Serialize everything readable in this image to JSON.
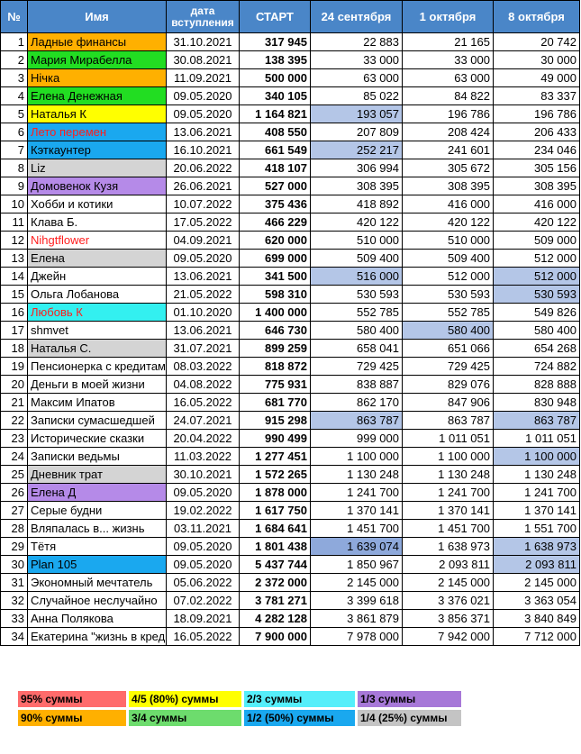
{
  "header": {
    "no": "№",
    "name": "Имя",
    "date": "дата вступления",
    "start": "СТАРТ",
    "c1": "24 сентября",
    "c2": "1 октября",
    "c3": "8 октября"
  },
  "colors": {
    "header": "#4a86c8",
    "orange": "#ffb000",
    "green": "#22dd22",
    "yellow": "#ffff00",
    "blue": "#1aa8ef",
    "gray": "#d4d4d4",
    "purple": "#b58ae8",
    "cyan": "#33f0f0",
    "highlight": "#b4c6e7",
    "highlight_strong": "#8ea9db"
  },
  "rows": [
    {
      "n": "1",
      "name": "Ладные финансы",
      "date": "31.10.2021",
      "start": "317 945",
      "c1": "22 883",
      "c2": "21 165",
      "c3": "20 742",
      "bg": "orange"
    },
    {
      "n": "2",
      "name": "Мария Мирабелла",
      "date": "30.08.2021",
      "start": "138 395",
      "c1": "33 000",
      "c2": "33 000",
      "c3": "30 000",
      "bg": "green"
    },
    {
      "n": "3",
      "name": "Нічка",
      "date": "11.09.2021",
      "start": "500 000",
      "c1": "63 000",
      "c2": "63 000",
      "c3": "49 000",
      "bg": "orange"
    },
    {
      "n": "4",
      "name": "Елена Денежная",
      "date": "09.05.2020",
      "start": "340 105",
      "c1": "85 022",
      "c2": "84 822",
      "c3": "83 337",
      "bg": "green"
    },
    {
      "n": "5",
      "name": "Наталья К",
      "date": "09.05.2020",
      "start": "1 164 821",
      "c1": "193 057",
      "c2": "196 786",
      "c3": "196 786",
      "bg": "yellow",
      "h1": true
    },
    {
      "n": "6",
      "name": "Лето перемен",
      "date": "13.06.2021",
      "start": "408 550",
      "c1": "207 809",
      "c2": "208 424",
      "c3": "206 433",
      "bg": "blue",
      "red": true
    },
    {
      "n": "7",
      "name": "Кэткаунтер",
      "date": "16.10.2021",
      "start": "661 549",
      "c1": "252 217",
      "c2": "241 601",
      "c3": "234 046",
      "bg": "blue",
      "h1": true
    },
    {
      "n": "8",
      "name": "Liz",
      "date": "20.06.2022",
      "start": "418 107",
      "c1": "306 994",
      "c2": "305 672",
      "c3": "305 156",
      "bg": "gray"
    },
    {
      "n": "9",
      "name": "Домовенок Кузя",
      "date": "26.06.2021",
      "start": "527 000",
      "c1": "308 395",
      "c2": "308 395",
      "c3": "308 395",
      "bg": "purple"
    },
    {
      "n": "10",
      "name": "Хобби и котики",
      "date": "10.07.2022",
      "start": "375 436",
      "c1": "418 892",
      "c2": "416 000",
      "c3": "416 000",
      "bg": ""
    },
    {
      "n": "11",
      "name": "Клава Б.",
      "date": "17.05.2022",
      "start": "466 229",
      "c1": "420 122",
      "c2": "420 122",
      "c3": "420 122",
      "bg": ""
    },
    {
      "n": "12",
      "name": "Nihgtflower",
      "date": "04.09.2021",
      "start": "620 000",
      "c1": "510 000",
      "c2": "510 000",
      "c3": "509 000",
      "bg": "",
      "red": true
    },
    {
      "n": "13",
      "name": "Елена",
      "date": "09.05.2020",
      "start": "699 000",
      "c1": "509 400",
      "c2": "509 400",
      "c3": "512 000",
      "bg": "gray"
    },
    {
      "n": "14",
      "name": "Джейн",
      "date": "13.06.2021",
      "start": "341 500",
      "c1": "516 000",
      "c2": "512 000",
      "c3": "512 000",
      "bg": "",
      "h1": true,
      "h3": true
    },
    {
      "n": "15",
      "name": "Ольга Лобанова",
      "date": "21.05.2022",
      "start": "598 310",
      "c1": "530 593",
      "c2": "530 593",
      "c3": "530 593",
      "bg": "",
      "h3": true
    },
    {
      "n": "16",
      "name": "Любовь К",
      "date": "01.10.2020",
      "start": "1 400 000",
      "c1": "552 785",
      "c2": "552 785",
      "c3": "549 826",
      "bg": "cyan",
      "red": true
    },
    {
      "n": "17",
      "name": "shmvet",
      "date": "13.06.2021",
      "start": "646 730",
      "c1": "580 400",
      "c2": "580 400",
      "c3": "580 400",
      "bg": "",
      "h2": true
    },
    {
      "n": "18",
      "name": "Наталья С.",
      "date": "31.07.2021",
      "start": "899 259",
      "c1": "658 041",
      "c2": "651 066",
      "c3": "654 268",
      "bg": "gray"
    },
    {
      "n": "19",
      "name": "Пенсионерка с кредитами",
      "date": "08.03.2022",
      "start": "818 872",
      "c1": "729 425",
      "c2": "729 425",
      "c3": "724 882",
      "bg": ""
    },
    {
      "n": "20",
      "name": "Деньги в моей жизни",
      "date": "04.08.2022",
      "start": "775 931",
      "c1": "838 887",
      "c2": "829 076",
      "c3": "828 888",
      "bg": ""
    },
    {
      "n": "21",
      "name": "Максим Ипатов",
      "date": "16.05.2022",
      "start": "681 770",
      "c1": "862 170",
      "c2": "847 906",
      "c3": "830 948",
      "bg": ""
    },
    {
      "n": "22",
      "name": "Записки сумасшедшей",
      "date": "24.07.2021",
      "start": "915 298",
      "c1": "863 787",
      "c2": "863 787",
      "c3": "863 787",
      "bg": "",
      "h1": true,
      "h3": true
    },
    {
      "n": "23",
      "name": "Исторические сказки",
      "date": "20.04.2022",
      "start": "990 499",
      "c1": "999 000",
      "c2": "1 011 051",
      "c3": "1 011 051",
      "bg": ""
    },
    {
      "n": "24",
      "name": "Записки ведьмы",
      "date": "11.03.2022",
      "start": "1 277 451",
      "c1": "1 100 000",
      "c2": "1 100 000",
      "c3": "1 100 000",
      "bg": "",
      "h3": true
    },
    {
      "n": "25",
      "name": "Дневник трат",
      "date": "30.10.2021",
      "start": "1 572 265",
      "c1": "1 130 248",
      "c2": "1 130 248",
      "c3": "1 130 248",
      "bg": "gray"
    },
    {
      "n": "26",
      "name": "Елена Д",
      "date": "09.05.2020",
      "start": "1 878 000",
      "c1": "1 241 700",
      "c2": "1 241 700",
      "c3": "1 241 700",
      "bg": "purple"
    },
    {
      "n": "27",
      "name": "Серые будни",
      "date": "19.02.2022",
      "start": "1 617 750",
      "c1": "1 370 141",
      "c2": "1 370 141",
      "c3": "1 370 141",
      "bg": ""
    },
    {
      "n": "28",
      "name": "Вляпалась в... жизнь",
      "date": "03.11.2021",
      "start": "1 684 641",
      "c1": "1 451 700",
      "c2": "1 451 700",
      "c3": "1 551 700",
      "bg": ""
    },
    {
      "n": "29",
      "name": "Тётя",
      "date": "09.05.2020",
      "start": "1 801 438",
      "c1": "1 639 074",
      "c2": "1 638 973",
      "c3": "1 638 973",
      "bg": "",
      "hs1": true,
      "h3": true
    },
    {
      "n": "30",
      "name": "Plan 105",
      "date": "09.05.2020",
      "start": "5 437 744",
      "c1": "1 850 967",
      "c2": "2 093 811",
      "c3": "2 093 811",
      "bg": "blue",
      "h3": true
    },
    {
      "n": "31",
      "name": "Экономный мечтатель",
      "date": "05.06.2022",
      "start": "2 372 000",
      "c1": "2 145 000",
      "c2": "2 145 000",
      "c3": "2 145 000",
      "bg": ""
    },
    {
      "n": "32",
      "name": "Случайное неслучайно",
      "date": "07.02.2022",
      "start": "3 781 271",
      "c1": "3 399 618",
      "c2": "3 376 021",
      "c3": "3 363 054",
      "bg": ""
    },
    {
      "n": "33",
      "name": "Анна Полякова",
      "date": "18.09.2021",
      "start": "4 282 128",
      "c1": "3 861 879",
      "c2": "3 856 371",
      "c3": "3 840 849",
      "bg": ""
    },
    {
      "n": "34",
      "name": "Екатерина \"жизнь в кредит\"",
      "date": "16.05.2022",
      "start": "7 900 000",
      "c1": "7 978 000",
      "c2": "7 942 000",
      "c3": "7 712 000",
      "bg": ""
    }
  ],
  "legend": [
    {
      "label": "95% суммы",
      "color": "#ff6b6b"
    },
    {
      "label": "4/5 (80%) суммы",
      "color": "#ffff00"
    },
    {
      "label": "2/3 суммы",
      "color": "#55eefa"
    },
    {
      "label": "1/3 суммы",
      "color": "#a778d8"
    },
    {
      "label": "90% суммы",
      "color": "#ffb000"
    },
    {
      "label": "3/4 суммы",
      "color": "#6ddc6d"
    },
    {
      "label": "1/2 (50%) суммы",
      "color": "#1aa8ef"
    },
    {
      "label": "1/4 (25%) суммы",
      "color": "#c4c4c4"
    }
  ]
}
